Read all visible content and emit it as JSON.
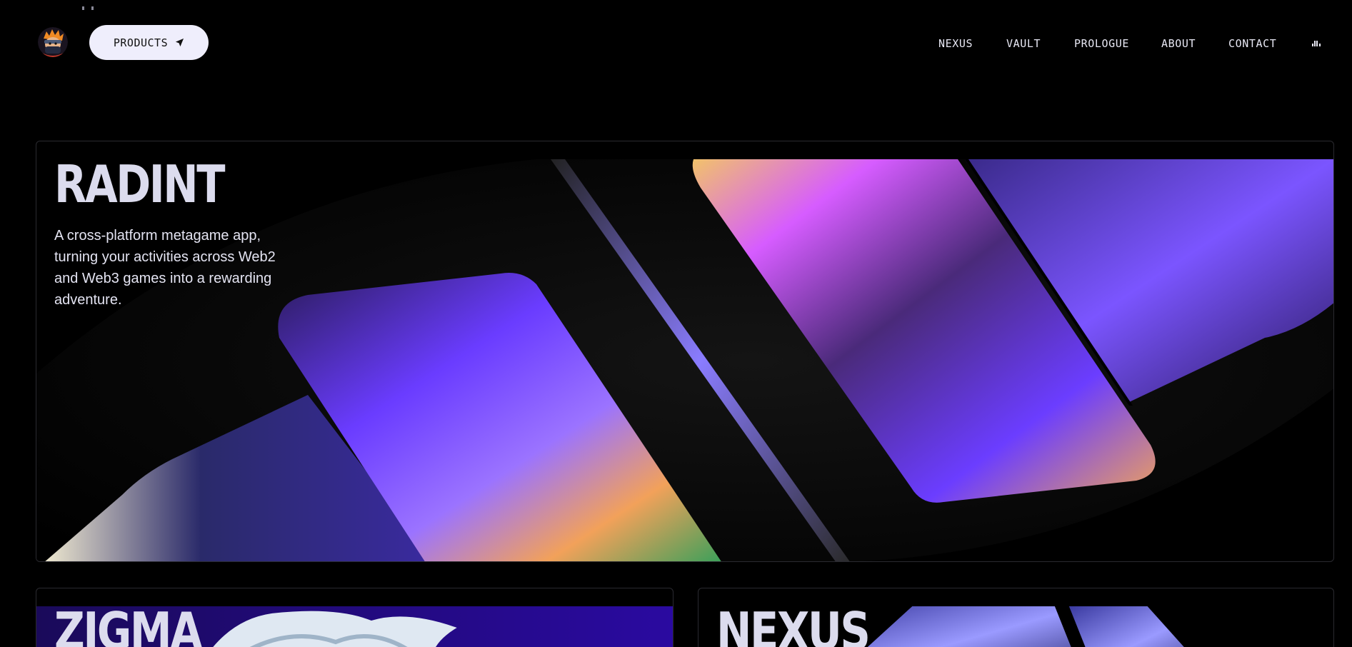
{
  "nav": {
    "logo_alt": "ninja mascot logo",
    "products_label": "PRODUCTS",
    "products_icon": "send-arrow-icon",
    "links": [
      {
        "label": "NEXUS"
      },
      {
        "label": "VAULT"
      },
      {
        "label": "PROLOGUE"
      },
      {
        "label": "ABOUT"
      },
      {
        "label": "CONTACT"
      }
    ],
    "audio_icon": "audio-bars-icon"
  },
  "hero": {
    "title": "RADINT",
    "description": "A cross-platform metagame app, turning your activities across Web2 and Web3 games into a rewarding adventure."
  },
  "cards": [
    {
      "title": "ZIGMA"
    },
    {
      "title": "NEXUS"
    }
  ],
  "colors": {
    "background": "#000000",
    "button_bg": "#efeefc",
    "text": "#dfdff0",
    "accent_purple": "#6a3cff",
    "accent_orange": "#f2a15a",
    "card_border": "#2a2a30"
  }
}
